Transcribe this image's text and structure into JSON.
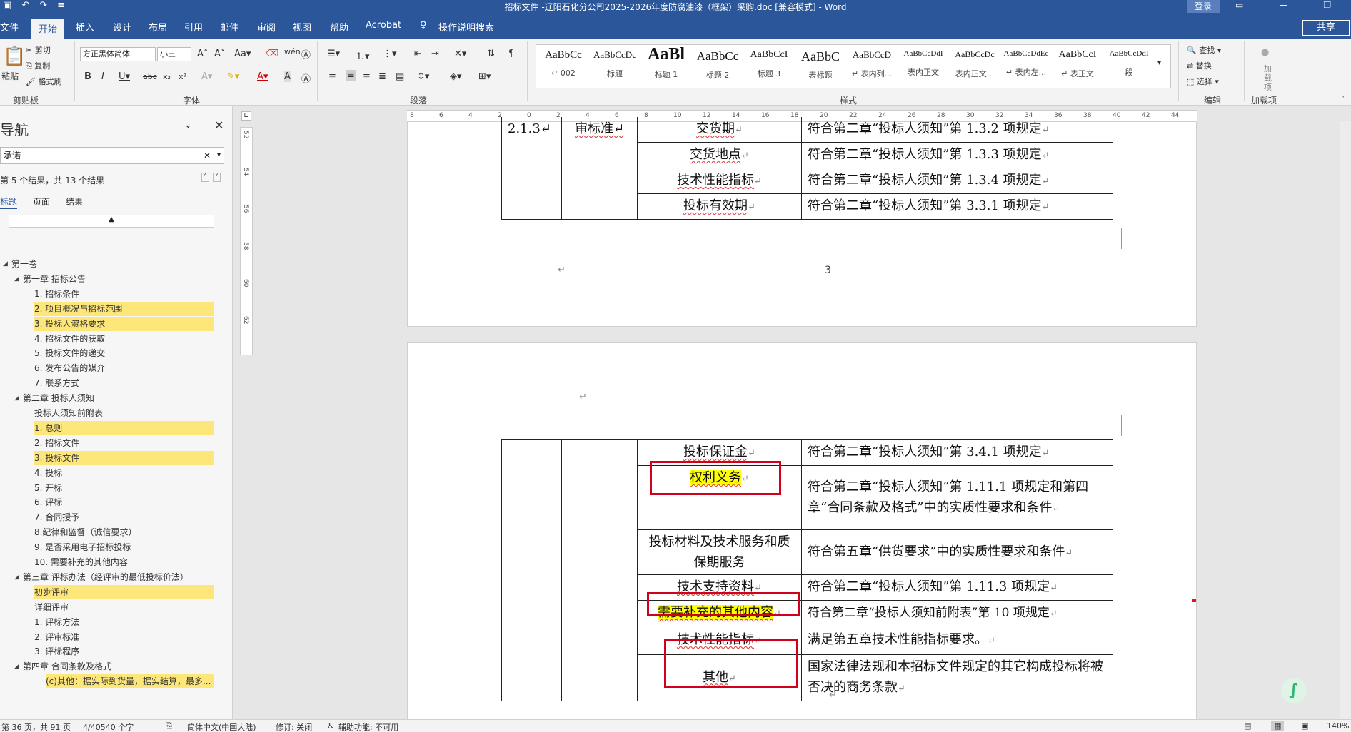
{
  "window": {
    "title": "招标文件 -辽阳石化分公司2025-2026年度防腐油漆（框架）采购.doc [兼容模式] - Word",
    "login": "登录",
    "share": "共享"
  },
  "menu": [
    "文件",
    "开始",
    "插入",
    "设计",
    "布局",
    "引用",
    "邮件",
    "审阅",
    "视图",
    "帮助",
    "Acrobat",
    "操作说明搜索"
  ],
  "ribbon": {
    "clipboard": {
      "paste": "粘贴",
      "cut": "剪切",
      "copy": "复制",
      "format_painter": "格式刷",
      "label": "剪贴板"
    },
    "font": {
      "name": "方正黑体简体",
      "size": "小三",
      "label": "字体"
    },
    "paragraph": {
      "label": "段落"
    },
    "styles": {
      "label": "样式",
      "items": [
        {
          "preview": "AaBbCc",
          "name": "↵ 002"
        },
        {
          "preview": "AaBbCcDc",
          "name": "标题"
        },
        {
          "preview": "AaBl",
          "name": "标题 1"
        },
        {
          "preview": "AaBbCc",
          "name": "标题 2"
        },
        {
          "preview": "AaBbCcI",
          "name": "标题 3"
        },
        {
          "preview": "AaBbC",
          "name": "表标题"
        },
        {
          "preview": "AaBbCcD",
          "name": "↵ 表内列..."
        },
        {
          "preview": "AaBbCcDdI",
          "name": "表内正文"
        },
        {
          "preview": "AaBbCcDc",
          "name": "表内正文..."
        },
        {
          "preview": "AaBbCcDdEe",
          "name": "↵ 表内左..."
        },
        {
          "preview": "AaBbCcI",
          "name": "↵ 表正文"
        },
        {
          "preview": "AaBbCcDdI",
          "name": "段"
        }
      ]
    },
    "editing": {
      "find": "查找",
      "replace": "替换",
      "select": "选择",
      "label": "编辑"
    },
    "addins": {
      "load": "加载项",
      "label": "加载项"
    }
  },
  "nav": {
    "title": "导航",
    "search_value": "承诺",
    "result_count": "第 5 个结果，共 13 个结果",
    "tabs": [
      "标题",
      "页面",
      "结果"
    ],
    "items": [
      {
        "text": "第一卷",
        "level": 0,
        "hl": false
      },
      {
        "text": "第一章  招标公告",
        "level": 1,
        "hl": false
      },
      {
        "text": "1. 招标条件",
        "level": 2,
        "hl": false
      },
      {
        "text": "2. 项目概况与招标范围",
        "level": 2,
        "hl": true
      },
      {
        "text": "3. 投标人资格要求",
        "level": 2,
        "hl": true
      },
      {
        "text": "4. 招标文件的获取",
        "level": 2,
        "hl": false
      },
      {
        "text": "5. 投标文件的递交",
        "level": 2,
        "hl": false
      },
      {
        "text": "6. 发布公告的媒介",
        "level": 2,
        "hl": false
      },
      {
        "text": "7. 联系方式",
        "level": 2,
        "hl": false
      },
      {
        "text": "第二章  投标人须知",
        "level": 1,
        "hl": false
      },
      {
        "text": "投标人须知前附表",
        "level": 2,
        "hl": false
      },
      {
        "text": "1. 总则",
        "level": 2,
        "hl": true
      },
      {
        "text": "2. 招标文件",
        "level": 2,
        "hl": false
      },
      {
        "text": "3. 投标文件",
        "level": 2,
        "hl": true
      },
      {
        "text": "4. 投标",
        "level": 2,
        "hl": false
      },
      {
        "text": "5. 开标",
        "level": 2,
        "hl": false
      },
      {
        "text": "6. 评标",
        "level": 2,
        "hl": false
      },
      {
        "text": "7. 合同授予",
        "level": 2,
        "hl": false
      },
      {
        "text": "8.纪律和监督（诚信要求）",
        "level": 2,
        "hl": false
      },
      {
        "text": "9. 是否采用电子招标投标",
        "level": 2,
        "hl": false
      },
      {
        "text": "10. 需要补充的其他内容",
        "level": 2,
        "hl": false
      },
      {
        "text": "第三章  评标办法（经评审的最低投标价法）",
        "level": 1,
        "hl": false
      },
      {
        "text": "初步评审",
        "level": 2,
        "hl": true
      },
      {
        "text": "详细评审",
        "level": 2,
        "hl": false
      },
      {
        "text": "1. 评标方法",
        "level": 2,
        "hl": false
      },
      {
        "text": "2. 评审标准",
        "level": 2,
        "hl": false
      },
      {
        "text": "3. 评标程序",
        "level": 2,
        "hl": false
      },
      {
        "text": "第四章  合同条款及格式",
        "level": 1,
        "hl": false
      },
      {
        "text": "(c)其他：据实际到货量，据实结算，最多...",
        "level": 3,
        "hl": true
      }
    ]
  },
  "page1": {
    "page_number": "3",
    "row_num": "2.1.3↵",
    "row_cat": "审标准↵",
    "rows": [
      {
        "item": "交货期",
        "std": "符合第二章“投标人须知”第 1.3.2 项规定"
      },
      {
        "item": "交货地点",
        "std": "符合第二章“投标人须知”第 1.3.3 项规定"
      },
      {
        "item": "技术性能指标",
        "std": "符合第二章“投标人须知”第 1.3.4 项规定"
      },
      {
        "item": "投标有效期",
        "std": "符合第二章“投标人须知”第 3.3.1 项规定"
      }
    ]
  },
  "page2": {
    "rows": [
      {
        "item": "投标保证金",
        "std": "符合第二章“投标人须知”第 3.4.1 项规定"
      },
      {
        "item": "权利义务",
        "std": "符合第二章“投标人须知”第 1.11.1 项规定和第四章“合同条款及格式”中的实质性要求和条件"
      },
      {
        "item": "投标材料及技术服务和质保期服务",
        "std": "符合第五章“供货要求”中的实质性要求和条件"
      },
      {
        "item": "技术支持资料",
        "std": "符合第二章“投标人须知”第 1.11.3 项规定"
      },
      {
        "item": "需要补充的其他内容",
        "std": "符合第二章“投标人须知前附表”第 10 项规定"
      },
      {
        "item": "技术性能指标",
        "std": "满足第五章技术性能指标要求。"
      },
      {
        "item": "其他",
        "std": "国家法律法规和本招标文件规定的其它构成投标将被否决的商务条款"
      }
    ]
  },
  "status": {
    "page": "第 36 页，共 91 页",
    "words": "4/40540 个字",
    "lang": "简体中文(中国大陆)",
    "track": "修订: 关闭",
    "access": "辅助功能: 不可用",
    "zoom": "140%"
  },
  "colors": {
    "brand": "#2b579a",
    "highlight": "#ffff00",
    "annotation": "#d0021b",
    "nav_highlight": "#fde67a"
  }
}
